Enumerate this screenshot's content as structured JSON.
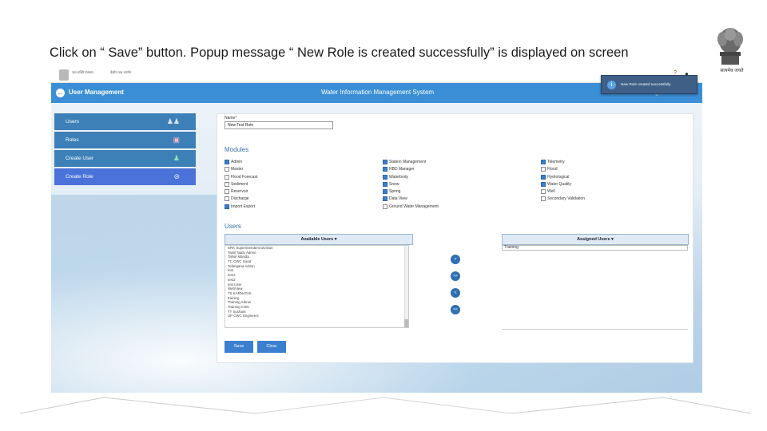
{
  "slide": {
    "instruction": "Click on “ Save” button. Popup message “ New Role is created successfully” is displayed on screen",
    "emblem_caption": "सत्यमेव जयते"
  },
  "app": {
    "gov_header_left": "जल शक्ति मंत्रालय",
    "gov_header_right": "केंद्रीय जल आयोग",
    "page_title": "User Management",
    "system_title": "Water Information Management System",
    "user_label": "Admin",
    "logout_label": "Logout"
  },
  "sidebar": {
    "items": [
      {
        "label": "Users",
        "icon": "users-icon"
      },
      {
        "label": "Roles",
        "icon": "roles-icon"
      },
      {
        "label": "Create User",
        "icon": "add-user-icon"
      },
      {
        "label": "Create Role",
        "icon": "create-role-icon"
      }
    ]
  },
  "form": {
    "name_label": "Name*",
    "name_value": "New Test Role",
    "modules_heading": "Modules",
    "users_heading": "Users"
  },
  "modules": {
    "col1": [
      {
        "label": "Admin",
        "checked": true
      },
      {
        "label": "Master",
        "checked": false
      },
      {
        "label": "Flood Forecast",
        "checked": false
      },
      {
        "label": "Sediment",
        "checked": false
      },
      {
        "label": "Reservoir",
        "checked": false
      },
      {
        "label": "Discharge",
        "checked": false
      },
      {
        "label": "Import Export",
        "checked": true
      }
    ],
    "col2": [
      {
        "label": "Station Management",
        "checked": true
      },
      {
        "label": "RBD Manager",
        "checked": true
      },
      {
        "label": "Waterbody",
        "checked": true
      },
      {
        "label": "Snow",
        "checked": true
      },
      {
        "label": "Spring",
        "checked": true
      },
      {
        "label": "Data View",
        "checked": true
      },
      {
        "label": "Ground Water Management",
        "checked": false
      }
    ],
    "col3": [
      {
        "label": "Telemetry",
        "checked": true
      },
      {
        "label": "Flood",
        "checked": false
      },
      {
        "label": "Hydrological",
        "checked": true
      },
      {
        "label": "Water Quality",
        "checked": true
      },
      {
        "label": "Well",
        "checked": false
      },
      {
        "label": "Secondary Validation",
        "checked": false
      }
    ]
  },
  "users": {
    "available_header": "Available Users",
    "assigned_header": "Assigned Users",
    "available": [
      "SRK Superintendent Division",
      "Tamil Nadu Admin",
      "Tahsil Mandla",
      "TC CWC Surat",
      "Telangana Admin",
      "test",
      "test1",
      "test2",
      "test User",
      "WebView",
      "TS KARNATAK",
      "training",
      "Training Admin",
      "Training CWC",
      "TT Sushant",
      "UP CWC Engineers"
    ],
    "assigned": "Training"
  },
  "move_buttons": [
    ">",
    ">>",
    "<",
    "<<"
  ],
  "buttons": {
    "save": "Save",
    "clear": "Clear"
  },
  "toast": {
    "message": "New Role created successfully"
  }
}
